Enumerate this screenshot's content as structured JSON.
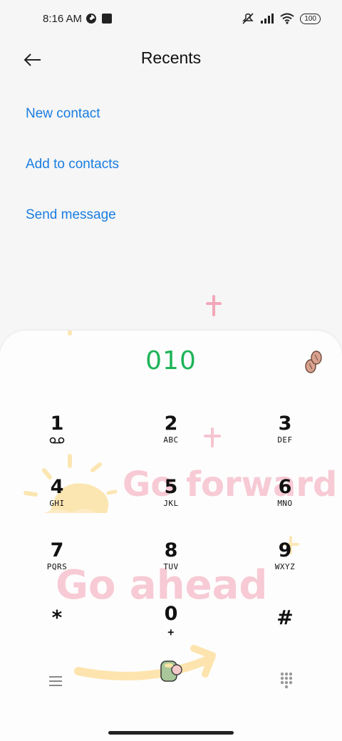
{
  "status_bar": {
    "time": "8:16 AM",
    "battery": "100"
  },
  "header": {
    "title": "Recents",
    "back_icon": "arrow-left-icon"
  },
  "actions": [
    {
      "label": "New contact"
    },
    {
      "label": "Add to contacts"
    },
    {
      "label": "Send message"
    }
  ],
  "dialer": {
    "number": "010",
    "keys": [
      {
        "digit": "1",
        "letters": ""
      },
      {
        "digit": "2",
        "letters": "ABC"
      },
      {
        "digit": "3",
        "letters": "DEF"
      },
      {
        "digit": "4",
        "letters": "GHI"
      },
      {
        "digit": "5",
        "letters": "JKL"
      },
      {
        "digit": "6",
        "letters": "MNO"
      },
      {
        "digit": "7",
        "letters": "PQRS"
      },
      {
        "digit": "8",
        "letters": "TUV"
      },
      {
        "digit": "9",
        "letters": "WXYZ"
      },
      {
        "digit": "*",
        "letters": ""
      },
      {
        "digit": "0",
        "letters": "+"
      },
      {
        "digit": "#",
        "letters": ""
      }
    ],
    "wallpaper_text_1": "Go forward",
    "wallpaper_text_2": "Go ahead"
  },
  "colors": {
    "accent_link": "#1a7de0",
    "number_green": "#1fb458"
  }
}
